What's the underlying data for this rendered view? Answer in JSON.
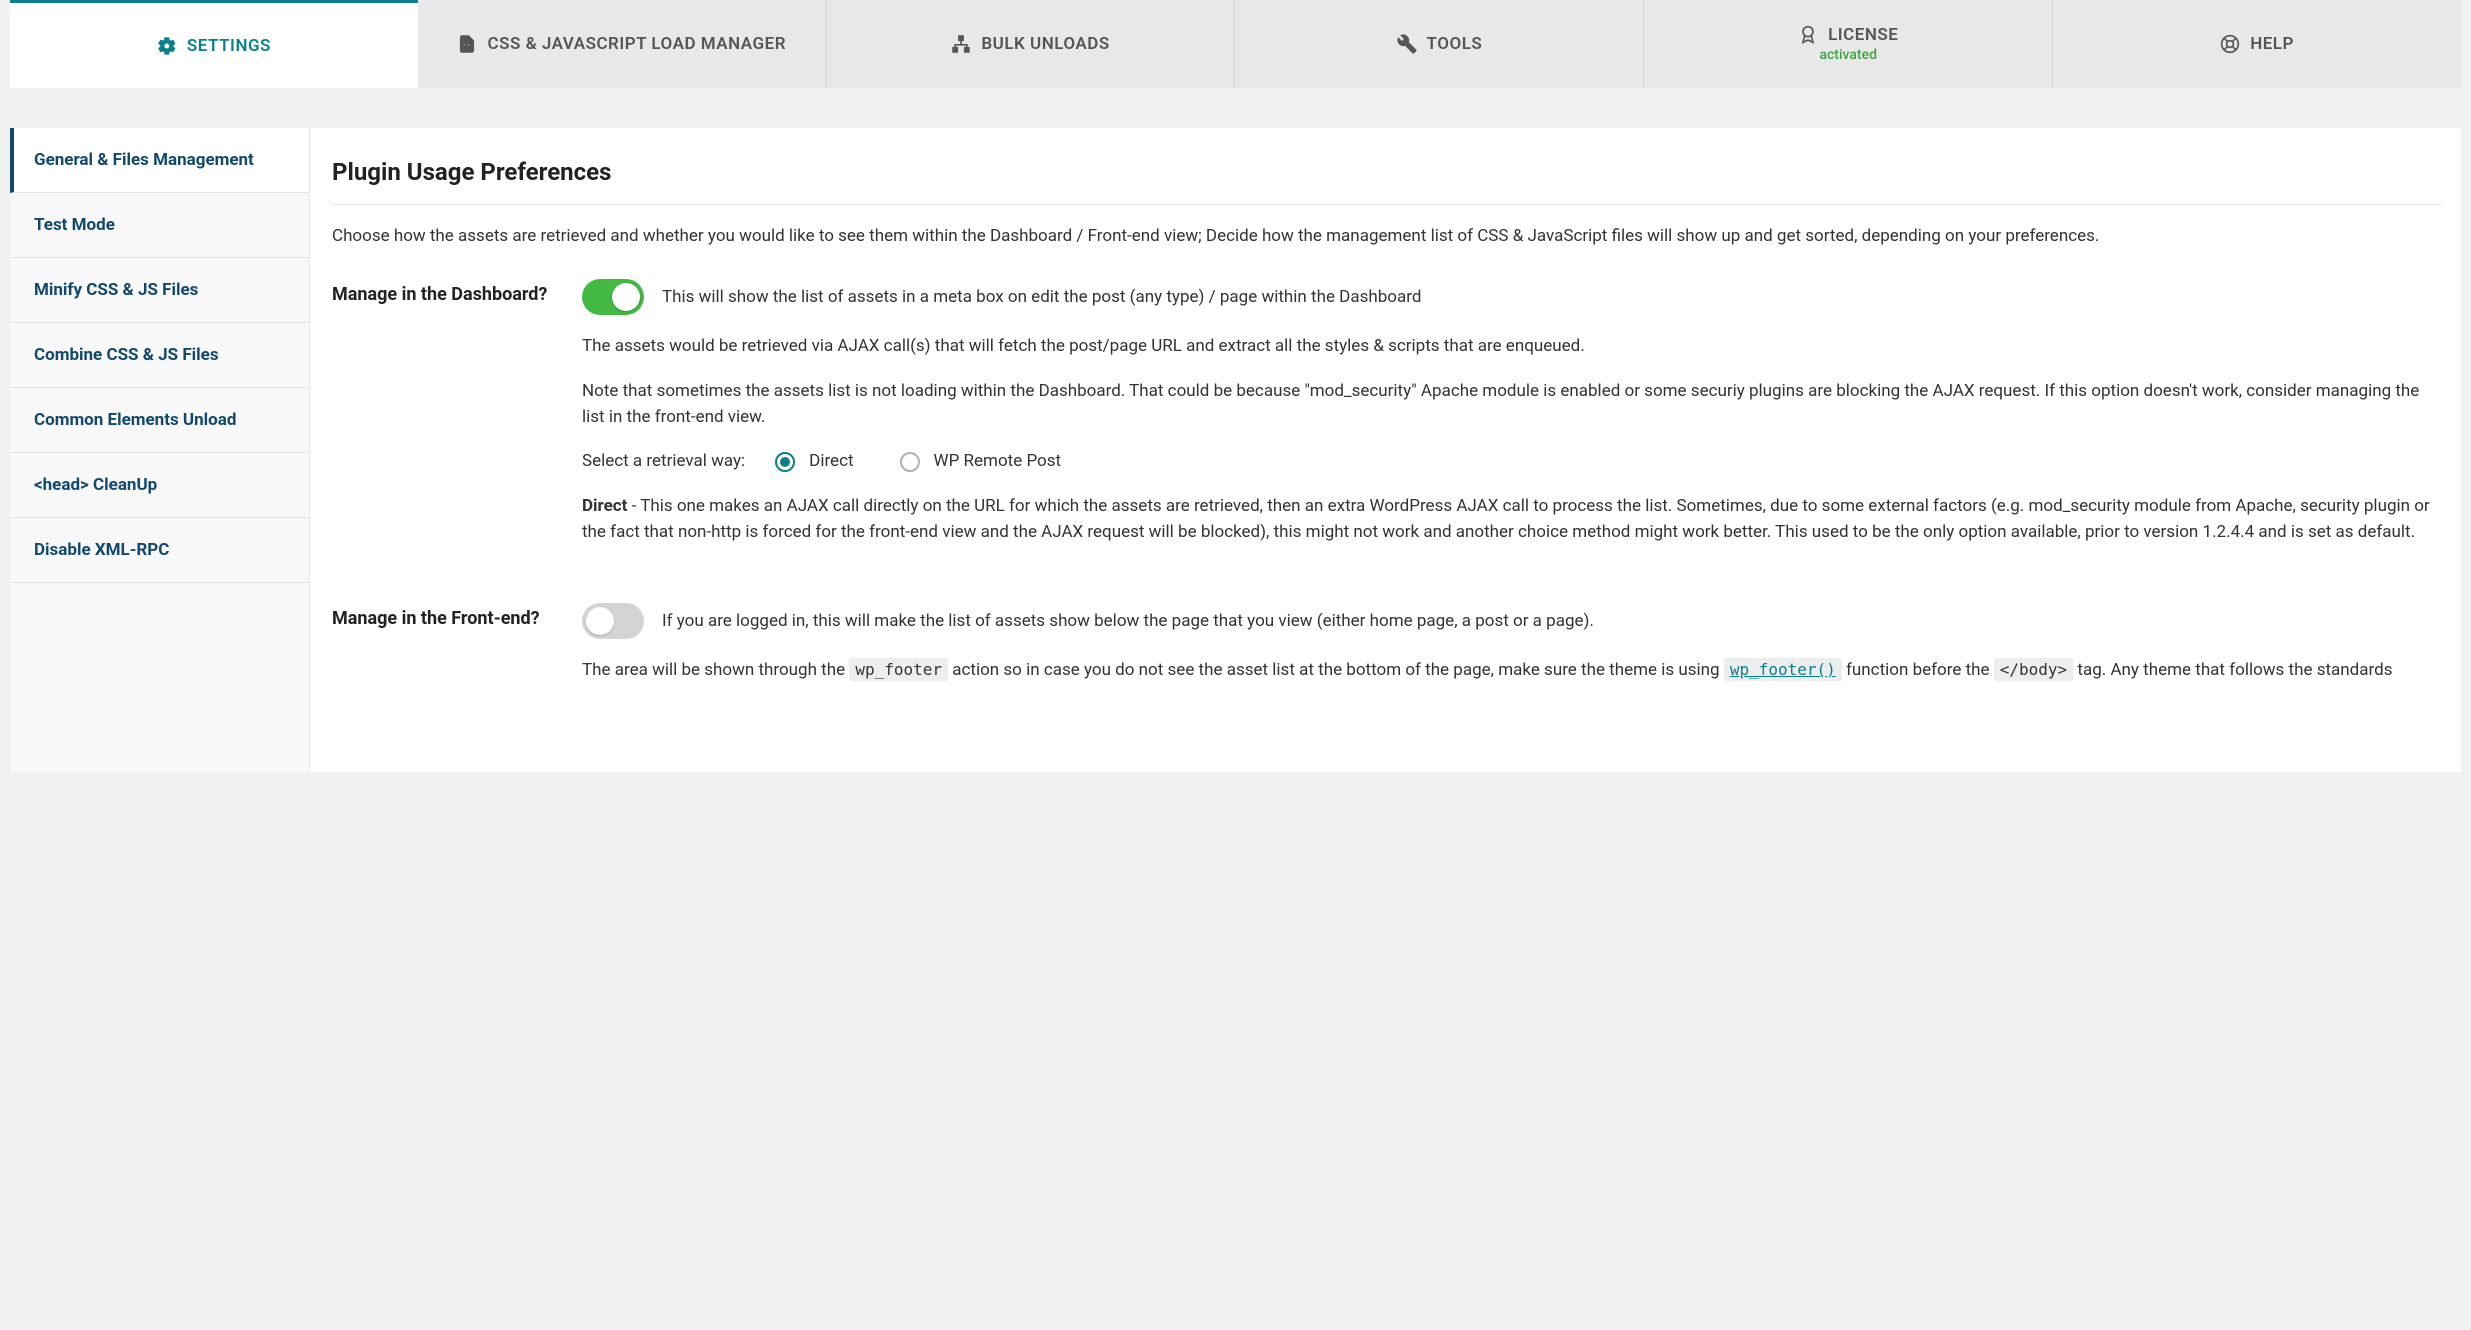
{
  "tabs": [
    {
      "label": "SETTINGS",
      "sub": ""
    },
    {
      "label": "CSS & JAVASCRIPT LOAD MANAGER",
      "sub": ""
    },
    {
      "label": "BULK UNLOADS",
      "sub": ""
    },
    {
      "label": "TOOLS",
      "sub": ""
    },
    {
      "label": "LICENSE",
      "sub": "activated"
    },
    {
      "label": "HELP",
      "sub": ""
    }
  ],
  "sidebar": {
    "items": [
      "General & Files Management",
      "Test Mode",
      "Minify CSS & JS Files",
      "Combine CSS & JS Files",
      "Common Elements Unload",
      "<head> CleanUp",
      "Disable XML-RPC"
    ]
  },
  "section": {
    "title": "Plugin Usage Preferences",
    "desc": "Choose how the assets are retrieved and whether you would like to see them within the Dashboard / Front-end view; Decide how the management list of CSS & JavaScript files will show up and get sorted, depending on your preferences."
  },
  "opt1": {
    "label": "Manage in the Dashboard?",
    "toggle_on": true,
    "line1": "This will show the list of assets in a meta box on edit the post (any type) / page within the Dashboard",
    "para1": "The assets would be retrieved via AJAX call(s) that will fetch the post/page URL and extract all the styles & scripts that are enqueued.",
    "para2": "Note that sometimes the assets list is not loading within the Dashboard. That could be because \"mod_security\" Apache module is enabled or some securiy plugins are blocking the AJAX request. If this option doesn't work, consider managing the list in the front-end view.",
    "retrieval_label": "Select a retrieval way:",
    "radio1": "Direct",
    "radio2": "WP Remote Post",
    "direct_heading": "Direct",
    "direct_rest": " - This one makes an AJAX call directly on the URL for which the assets are retrieved, then an extra WordPress AJAX call to process the list. Sometimes, due to some external factors (e.g. mod_security module from Apache, security plugin or the fact that non-http is forced for the front-end view and the AJAX request will be blocked), this might not work and another choice method might work better. This used to be the only option available, prior to version 1.2.4.4 and is set as default."
  },
  "opt2": {
    "label": "Manage in the Front-end?",
    "toggle_on": false,
    "line1": "If you are logged in, this will make the list of assets show below the page that you view (either home page, a post or a page).",
    "para_pre": "The area will be shown through the ",
    "code1": "wp_footer",
    "para_mid1": " action so in case you do not see the asset list at the bottom of the page, make sure the theme is using ",
    "code2": "wp_footer()",
    "para_mid2": " function before the ",
    "code3": "</body>",
    "para_post": " tag. Any theme that follows the standards"
  }
}
